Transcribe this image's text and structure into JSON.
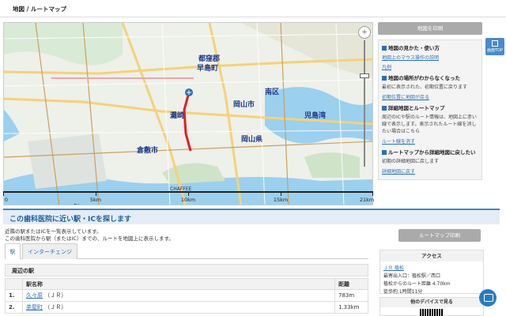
{
  "breadcrumb": {
    "text": "地図 / ルートマップ"
  },
  "map": {
    "labels": [
      "都窪郡",
      "早島町",
      "岡山市",
      "南区",
      "倉敷市",
      "児島湾",
      "岡山県",
      "灘崎"
    ],
    "scale_ticks": [
      "0",
      "5km",
      "10km",
      "15km",
      "21km"
    ],
    "scale_left": "5km",
    "map_icon": "snowflake-marker-icon",
    "credit": "CHAFFEE"
  },
  "right": {
    "print_map": "地図を印刷",
    "page_top": "画面TOP",
    "sections": [
      {
        "title": "地図の見かた・使い方",
        "links": [
          "地図上のマウス操作の説明",
          "凡例"
        ]
      },
      {
        "title": "地図の場所がわからなくなった",
        "text": "最初に表示された、初期位置に戻ります",
        "links": [
          "初期位置に地図が戻る"
        ]
      },
      {
        "title": "詳細地図とルートマップ",
        "text": "周辺のICや駅のルート情報は、地図上に赤い線で表示します。表示されたルート線を消したい場合はこちら",
        "links": [
          "ルート線を消す"
        ]
      },
      {
        "title": "ルートマップから詳細地図に戻したい",
        "text": "初期の詳細地図に戻します",
        "links": [
          "詳細地図に戻す"
        ]
      }
    ]
  },
  "station_section": {
    "heading": "この歯科医院に近い駅・ICを探します",
    "desc_line1": "近隣の駅またはICを一覧表示しています。",
    "desc_line2": "この歯科医院から駅（またはIC）までの、ルートを地図上に表示します。",
    "tabs": [
      "駅",
      "インターチェンジ"
    ],
    "nearby_title": "周辺の駅",
    "table_headers": [
      "駅名称",
      "距離"
    ],
    "rows": [
      {
        "no": "1.",
        "name": "久々原",
        "line": "（ＪＲ）",
        "dist": "783m"
      },
      {
        "no": "2.",
        "name": "茶屋町",
        "line": "（ＪＲ）",
        "dist": "1.33km"
      }
    ]
  },
  "route_panel": {
    "print_btn": "ルートマップ印刷",
    "access_title": "アクセス",
    "access_station": "ＪＲ 植松",
    "access_lines": [
      "最寄出入口：植松駅／西口",
      "植松からのルート距離 4.70km",
      "徒歩約 1時間11分"
    ],
    "device_title": "他のデバイスで見る"
  }
}
